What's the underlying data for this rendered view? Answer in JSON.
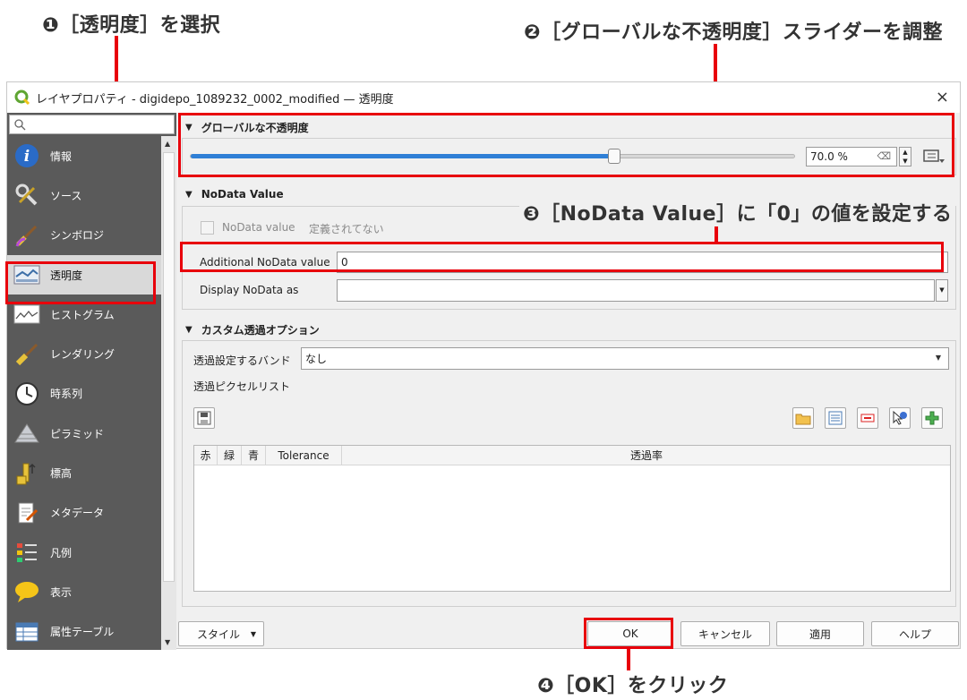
{
  "annotations": {
    "step1": "❶［透明度］を選択",
    "step2": "❷［グローバルな不透明度］スライダーを調整",
    "step3": "❸［NoData Value］に「0」の値を設定する",
    "step4": "❹［OK］をクリック"
  },
  "window": {
    "title": "レイヤプロパティ - digidepo_1089232_0002_modified — 透明度",
    "close": "×"
  },
  "sidebar": {
    "items": [
      {
        "label": "情報",
        "icon": "info-icon"
      },
      {
        "label": "ソース",
        "icon": "source-tools-icon"
      },
      {
        "label": "シンボロジ",
        "icon": "brush-icon"
      },
      {
        "label": "透明度",
        "icon": "transparency-icon"
      },
      {
        "label": "ヒストグラム",
        "icon": "histogram-icon"
      },
      {
        "label": "レンダリング",
        "icon": "paintbrush-icon"
      },
      {
        "label": "時系列",
        "icon": "clock-icon"
      },
      {
        "label": "ピラミッド",
        "icon": "pyramid-icon"
      },
      {
        "label": "標高",
        "icon": "elevation-icon"
      },
      {
        "label": "メタデータ",
        "icon": "metadata-icon"
      },
      {
        "label": "凡例",
        "icon": "legend-icon"
      },
      {
        "label": "表示",
        "icon": "speech-bubble-icon"
      },
      {
        "label": "属性テーブル",
        "icon": "table-icon"
      }
    ],
    "selected": "透明度"
  },
  "global_opacity": {
    "title": "グローバルな不透明度",
    "value_text": "70.0 %",
    "value": 0.7
  },
  "nodata": {
    "title": "NoData Value",
    "checkbox_label": "NoData value",
    "checkbox_value": "定義されてない",
    "additional_label": "Additional NoData value",
    "additional_value": "0",
    "display_label": "Display NoData as",
    "display_value": ""
  },
  "custom": {
    "title": "カスタム透過オプション",
    "band_label": "透過設定するバンド",
    "band_value": "なし",
    "pixel_list_label": "透過ピクセルリスト",
    "columns": [
      "赤",
      "緑",
      "青",
      "Tolerance",
      "透過率"
    ]
  },
  "buttons": {
    "style": "スタイル",
    "ok": "OK",
    "cancel": "キャンセル",
    "apply": "適用",
    "help": "ヘルプ"
  },
  "colors": {
    "highlight": "#e8000b",
    "slider": "#2f7fd6",
    "sidebar_bg": "#5a5a5a"
  }
}
